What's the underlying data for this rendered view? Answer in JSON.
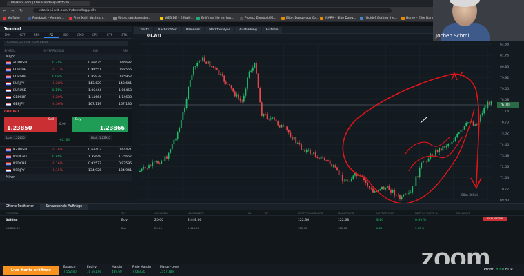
{
  "browser": {
    "tab_title": "Markets.com | Das Handelsplattform",
    "url": "xstation5.xtb.com/#/demo/loggedIn",
    "bookmarks": [
      "YouTube",
      "Facebook – Anmeld...",
      "Free Mail: Nachrich...",
      "Wirtschaftskalender...",
      "WEB.DE – E-Mail-...",
      "Eröffnen Sie ein kos...",
      "Project Zomboid M...",
      "Elite: Dangerous Ga...",
      "INARA – Elite Dang...",
      "[Guide] Getting the...",
      "Home – Elite Dang..."
    ]
  },
  "terminal": {
    "title": "Terminal",
    "tabs": [
      "1KK",
      "HOT",
      "SEK",
      "FX",
      "IND",
      "CMD",
      "CRY",
      "ETF",
      "STK"
    ],
    "active_tab": "FX",
    "search_placeholder": "Suchen Sie GUE nach FX/Flt",
    "col_symbol": "SYMBOL",
    "col_change": "% VERÄNDERN",
    "col_bid": "BID",
    "col_ask": "ASK",
    "group_major": "Major",
    "major_rows": [
      {
        "sym": "AUDUSD",
        "chg": "0.21%",
        "bid": "0.66675",
        "ask": "0.66687",
        "dir": "pos"
      },
      {
        "sym": "EURCHF",
        "chg": "-0.11%",
        "bid": "0.98551",
        "ask": "0.98566",
        "dir": "neg"
      },
      {
        "sym": "EURGBP",
        "chg": "0.08%",
        "bid": "0.85938",
        "ask": "0.85952",
        "dir": "pos"
      },
      {
        "sym": "EURJPY",
        "chg": "-0.28%",
        "bid": "143.629",
        "ask": "143.641",
        "dir": "neg"
      },
      {
        "sym": "EURUSD",
        "chg": "0.11%",
        "bid": "1.06444",
        "ask": "1.06453",
        "dir": "pos"
      },
      {
        "sym": "GBPCHF",
        "chg": "-0.20%",
        "bid": "1.14664",
        "ask": "1.14683",
        "dir": "neg"
      },
      {
        "sym": "GBPJPY",
        "chg": "-0.36%",
        "bid": "167.119",
        "ask": "167.135",
        "dir": "neg"
      }
    ],
    "trade": {
      "symbol": "GBPUSD",
      "sell_label": "Sell",
      "buy_label": "Buy",
      "sell_price": "1.23850",
      "buy_price": "1.23866",
      "volume": "0.90",
      "low": "Low: 1.22410",
      "high": "High: 1.23935",
      "spread": "+0.16%"
    },
    "lower_rows": [
      {
        "sym": "NZDUSD",
        "chg": "-0.16%",
        "bid": "0.64407",
        "ask": "0.64421",
        "dir": "neg"
      },
      {
        "sym": "USDCAD",
        "chg": "0.14%",
        "bid": "1.35649",
        "ask": "1.35667",
        "dir": "pos"
      },
      {
        "sym": "USDCHF",
        "chg": "-0.16%",
        "bid": "0.92577",
        "ask": "0.92595",
        "dir": "neg"
      },
      {
        "sym": "USDJPY",
        "chg": "-0.15%",
        "bid": "134.926",
        "ask": "134.941",
        "dir": "neg"
      }
    ],
    "group_minor": "Minor"
  },
  "chart": {
    "toolbar": [
      "Charts",
      "Nachrichten",
      "Kalender",
      "Marktanalyse",
      "Ausbildung",
      "Historie"
    ],
    "symbol": "OIL.WTI",
    "x_labels": [
      "30.11 2022 03:00",
      "01.12 06:00",
      "02.12 09:00",
      "05.12 13:00",
      "06.12 16:00",
      "07.12 19:00",
      "08.12 22:00",
      "12.12 03:00",
      "13.12 06:00",
      "14.12 09:00",
      "15.12 11:00"
    ],
    "y_labels": [
      "82.68",
      "81.76",
      "80.85",
      "79.92",
      "79.00",
      "78.08",
      "77.16",
      "76.70",
      "75.32",
      "74.40",
      "73.48",
      "72.56",
      "71.64",
      "70.72",
      "69.80"
    ],
    "current_price": "76.70",
    "countdown": "00m 36Sek",
    "symbol_tabs": [
      "EUR...",
      "GOLD...",
      "DE30...",
      "US30...",
      "Adida...",
      "OIL.W...",
      "Zoom...",
      "BITC...",
      "SUI20...",
      "US50...",
      "US10...",
      "CHFJ...",
      "SILVE...",
      "Ratex...",
      "NATG...",
      "GBPU..."
    ],
    "active_symbol_tab": "OIL.W..."
  },
  "positions": {
    "tabs": [
      "Offene Positionen",
      "Schwebende Aufträge"
    ],
    "headers": [
      "POSITION",
      "TYP",
      "VOLUMEN",
      "MARKTWERT",
      "SL",
      "TP",
      "ERÖFFNUNGSKURS",
      "MARKTKURS",
      "NETTOPROFIT",
      "NETTO-PROFIT %",
      "ROLLOVER"
    ],
    "row": {
      "name": "Adidas",
      "type": "Buy",
      "volume": "20.00",
      "value": "2 448.00",
      "open": "122.36",
      "market": "122.68",
      "profit": "8.80",
      "profit_pct": "0.03 %"
    },
    "subrow": {
      "name": "ADIDAS.DE",
      "type": "Buy",
      "volume": "20.00",
      "value": "2 448.00",
      "open": "122.36",
      "market": "122.68",
      "profit": "8.80",
      "profit_pct": "0.03 %"
    },
    "close_all": "SCHLIESSEN"
  },
  "account": {
    "live_button": "Live-Konto eröffnen",
    "stats": [
      {
        "label": "Balance",
        "value": "7 552.80"
      },
      {
        "label": "Equity",
        "value": "10 561.60"
      },
      {
        "label": "Margin",
        "value": "489.60"
      },
      {
        "label": "Freie Margin",
        "value": "7 063.20"
      },
      {
        "label": "Margin-Level",
        "value": "2157.18%"
      }
    ],
    "profit_label": "Profit:",
    "profit_value": "8.80",
    "currency": "EUR"
  },
  "zoom": {
    "participant_name": "Jochen Schmi...",
    "logo": "zoom"
  },
  "colors": {
    "up": "#1fbf6a",
    "down": "#e8464a",
    "annotation": "#e0151a"
  }
}
